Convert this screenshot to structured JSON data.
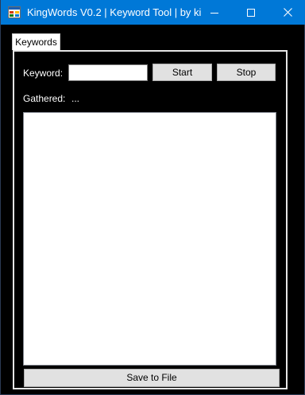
{
  "window": {
    "title": "KingWords V0.2 | Keyword Tool | by ki...",
    "icons": {
      "app": "app-icon",
      "minimize": "minimize-icon",
      "maximize": "maximize-icon",
      "close": "close-icon"
    },
    "titlebar_color": "#0078d7"
  },
  "tabs": [
    {
      "label": "Keywords",
      "selected": true
    }
  ],
  "form": {
    "keyword_label": "Keyword:",
    "keyword_value": "",
    "start_label": "Start",
    "stop_label": "Stop",
    "gathered_label": "Gathered:",
    "gathered_value": "..."
  },
  "results": {
    "items": []
  },
  "footer": {
    "save_label": "Save to File"
  }
}
